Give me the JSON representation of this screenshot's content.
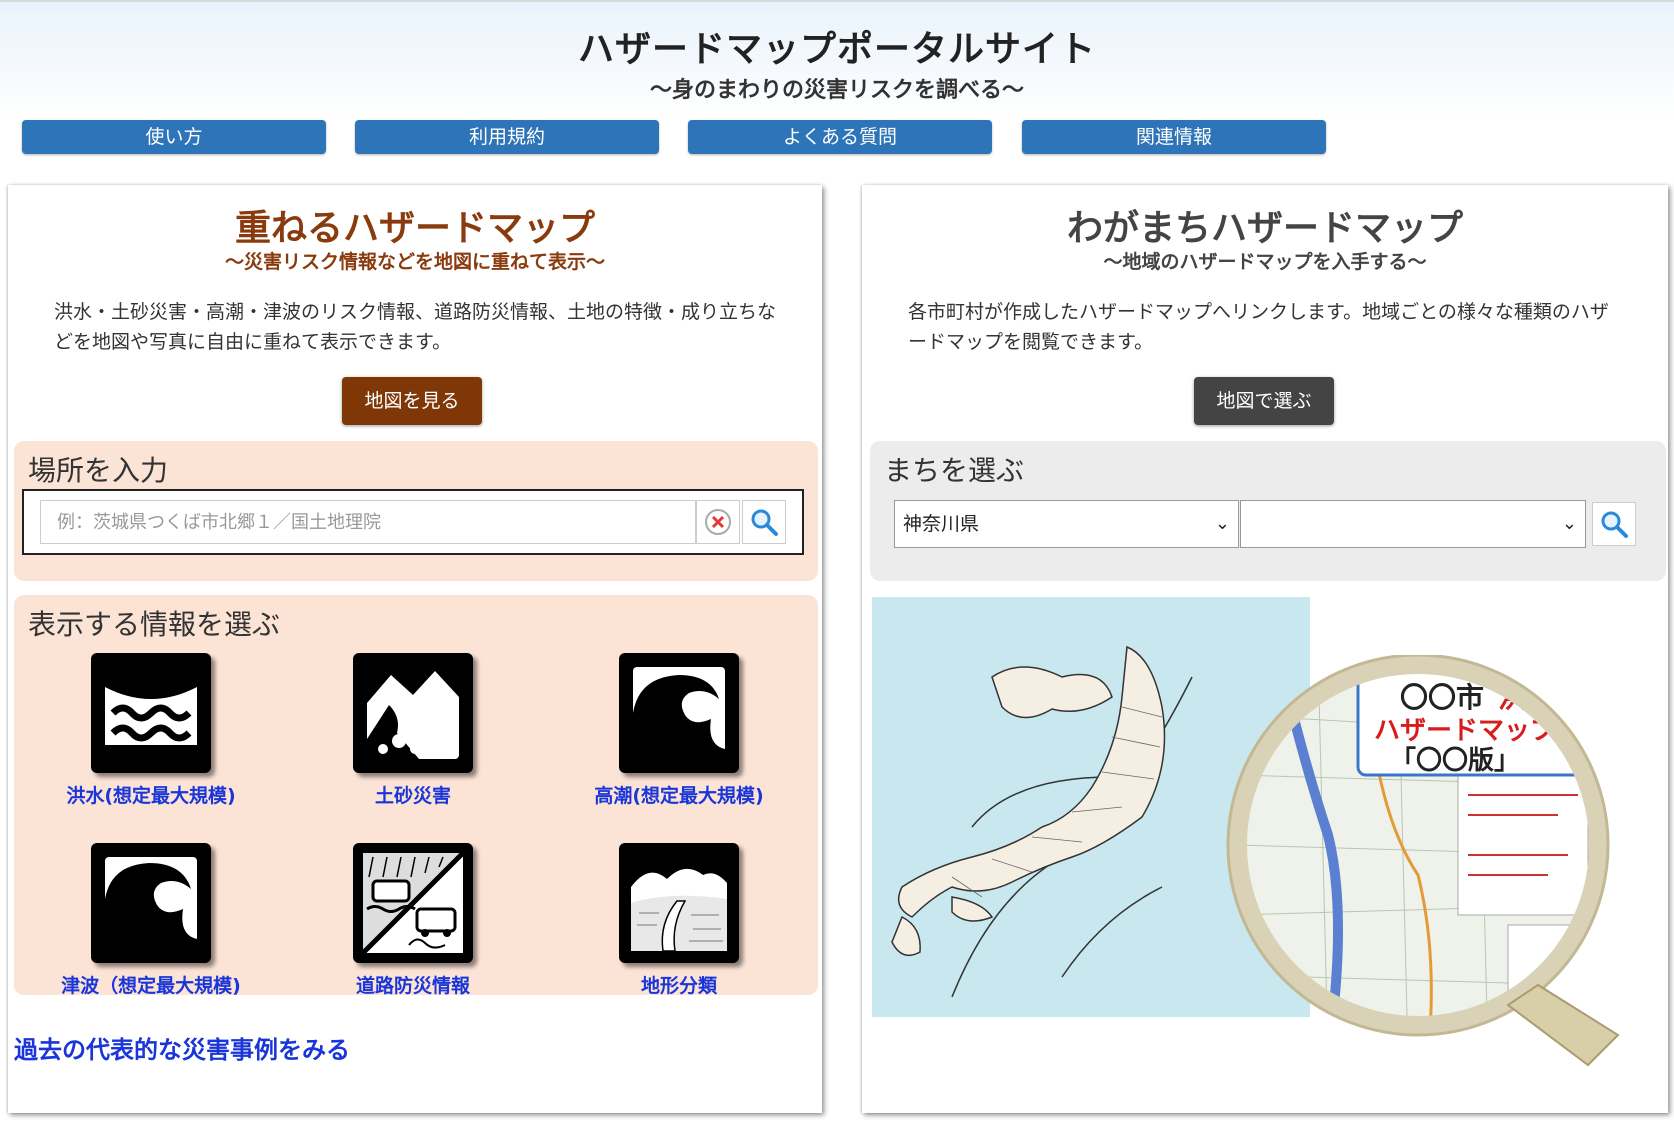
{
  "header": {
    "title": "ハザードマップポータルサイト",
    "subtitle": "～身のまわりの災害リスクを調べる～"
  },
  "nav": [
    "使い方",
    "利用規約",
    "よくある質問",
    "関連情報"
  ],
  "left_panel": {
    "title": "重ねるハザードマップ",
    "subtitle": "～災害リスク情報などを地図に重ねて表示～",
    "description": "洪水・土砂災害・高潮・津波のリスク情報、道路防災情報、土地の特徴・成り立ちなどを地図や写真に自由に重ねて表示できます。",
    "view_map_button": "地図を見る",
    "location_box": {
      "label": "場所を入力",
      "placeholder": "例：茨城県つくば市北郷１／国土地理院"
    },
    "info_box": {
      "label": "表示する情報を選ぶ",
      "items": [
        {
          "label": "洪水(想定最大規模)",
          "icon": "flood-icon"
        },
        {
          "label": "土砂災害",
          "icon": "landslide-icon"
        },
        {
          "label": "高潮(想定最大規模)",
          "icon": "storm-surge-icon"
        },
        {
          "label": "津波（想定最大規模)",
          "icon": "tsunami-icon"
        },
        {
          "label": "道路防災情報",
          "icon": "road-disaster-icon"
        },
        {
          "label": "地形分類",
          "icon": "landform-icon"
        }
      ]
    },
    "past_disasters_link": "過去の代表的な災害事例をみる"
  },
  "right_panel": {
    "title": "わがまちハザードマップ",
    "subtitle": "～地域のハザードマップを入手する～",
    "description": "各市町村が作成したハザードマップへリンクします。地域ごとの様々な種類のハザードマップを閲覧できます。",
    "select_on_map_button": "地図で選ぶ",
    "town_box": {
      "label": "まちを選ぶ",
      "prefecture_selected": "神奈川県",
      "municipality_selected": ""
    },
    "illustration": {
      "magnifier_line1_black": "〇〇市",
      "magnifier_line1_red": "洪水",
      "magnifier_line2": "ハザードマップ",
      "magnifier_line3": "「〇〇版」"
    }
  },
  "colors": {
    "nav_blue": "#2e74b8",
    "left_title": "#8a3b0e",
    "left_button": "#7f3708",
    "box_bg": "#fbe3d6",
    "right_button": "#444444",
    "link": "#1a35d9"
  }
}
